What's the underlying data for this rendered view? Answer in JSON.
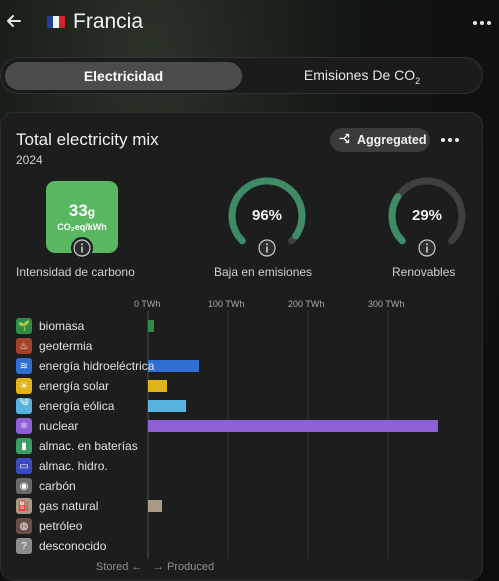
{
  "header": {
    "title": "Francia",
    "flag_colors": [
      "#1f3f9a",
      "#f2f2f2",
      "#d5232e"
    ]
  },
  "tabs": [
    {
      "label": "Electricidad",
      "active": true
    },
    {
      "label": "Emisiones De CO",
      "sub": "2",
      "active": false
    }
  ],
  "card": {
    "title": "Total electricity mix",
    "year": "2024",
    "aggregated_label": "Aggregated"
  },
  "metrics": {
    "carbon_intensity": {
      "value": "33",
      "unit_suffix": "g",
      "unit": "CO₂eq/kWh",
      "label": "Intensidad de carbono",
      "color": "#57b861"
    },
    "low_emissions": {
      "value": "96%",
      "fraction": 0.96,
      "label": "Baja en emisiones"
    },
    "renewables": {
      "value": "29%",
      "fraction": 0.29,
      "label": "Renovables"
    },
    "gauge_color": "#3f8a67",
    "gauge_track": "#3d403e"
  },
  "chart_data": {
    "type": "bar",
    "orientation": "horizontal",
    "x_ticks": [
      "0 TWh",
      "100 TWh",
      "200 TWh",
      "300 TWh"
    ],
    "xlim": [
      0,
      400
    ],
    "categories": [
      "biomasa",
      "geotermia",
      "energía hidroeléctrica",
      "energía solar",
      "energía eólica",
      "nuclear",
      "almac. en baterías",
      "almac. hidro.",
      "carbón",
      "gas natural",
      "petróleo",
      "desconocido"
    ],
    "values": [
      8,
      0,
      64,
      24,
      47,
      362,
      0,
      0,
      0,
      17,
      0,
      0
    ],
    "colors": [
      "#2e8b4a",
      "#a5432a",
      "#2f6fd3",
      "#e0b418",
      "#57b3e0",
      "#8e60d6",
      "#3d9e63",
      "#3b4bc1",
      "#6a6a6a",
      "#a89a87",
      "#6b4e47",
      "#8c8c8c"
    ],
    "icons": [
      "🌱",
      "♨",
      "≋",
      "☀",
      "༄",
      "⚛",
      "▮",
      "▭",
      "◉",
      "⛽",
      "◍",
      "?"
    ],
    "footer_stored": "Stored ←",
    "footer_produced": "→ Produced"
  }
}
